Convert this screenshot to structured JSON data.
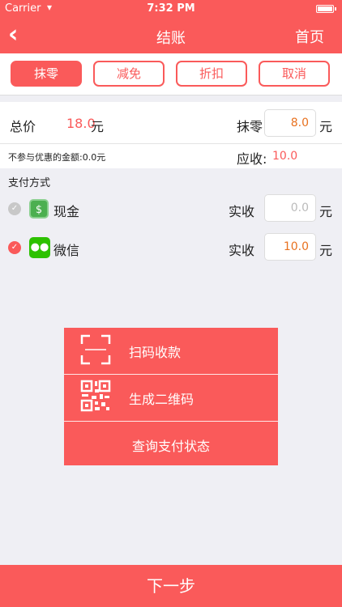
{
  "status_bar": {
    "carrier": "Carrier",
    "time": "7:32 PM"
  },
  "nav": {
    "back_icon": "chevron-left-icon",
    "title": "结账",
    "home": "首页"
  },
  "tabs": [
    {
      "label": "抹零",
      "active": true
    },
    {
      "label": "减免",
      "active": false
    },
    {
      "label": "折扣",
      "active": false
    },
    {
      "label": "取消",
      "active": false
    }
  ],
  "total": {
    "label": "总价",
    "value": "18.0",
    "unit": "元"
  },
  "rounding": {
    "label": "抹零",
    "value": "8.0",
    "unit": "元"
  },
  "excluded": {
    "text": "不参与优惠的金额:0.0元"
  },
  "receivable": {
    "label": "应收:",
    "value": "10.0"
  },
  "payment_section": {
    "title": "支付方式"
  },
  "methods": [
    {
      "name": "现金",
      "icon": "cash-icon",
      "checked": false,
      "received_label": "实收",
      "value": "",
      "placeholder": "0.0",
      "unit": "元"
    },
    {
      "name": "微信",
      "icon": "wechat-icon",
      "checked": true,
      "received_label": "实收",
      "value": "10.0",
      "placeholder": "",
      "unit": "元"
    }
  ],
  "menu": {
    "scan": {
      "label": "扫码收款",
      "icon": "scan-frame-icon"
    },
    "qr": {
      "label": "生成二维码",
      "icon": "qr-code-icon"
    },
    "query": {
      "label": "查询支付状态"
    }
  },
  "next": {
    "label": "下一步"
  },
  "colors": {
    "accent": "#fa5a5a",
    "amount": "#e8711f",
    "cash": "#4caf50",
    "wechat": "#2dc100"
  }
}
